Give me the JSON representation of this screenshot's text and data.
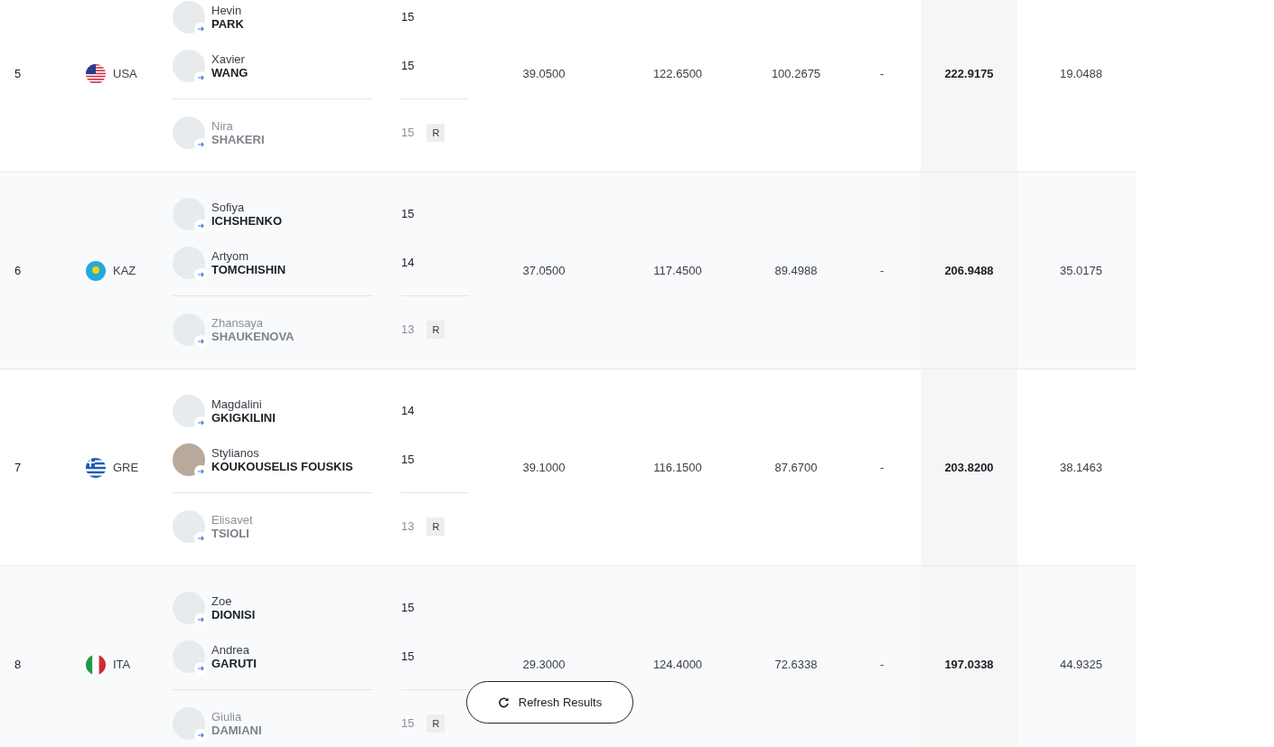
{
  "rows": [
    {
      "rank": "5",
      "country": "USA",
      "kind": "us",
      "athletes": [
        {
          "first": "Hevin",
          "last": "PARK",
          "score": "15",
          "reserve": false,
          "photo": false
        },
        {
          "first": "Xavier",
          "last": "WANG",
          "score": "15",
          "reserve": false,
          "photo": false
        },
        {
          "first": "Nira",
          "last": "SHAKERI",
          "score": "15",
          "reserve": true,
          "badge": "R",
          "photo": false
        }
      ],
      "values": [
        "39.0500",
        "122.6500",
        "100.2675",
        "-"
      ],
      "total": "222.9175",
      "gap": "19.0488"
    },
    {
      "rank": "6",
      "country": "KAZ",
      "kind": "kz",
      "athletes": [
        {
          "first": "Sofiya",
          "last": "ICHSHENKO",
          "score": "15",
          "reserve": false,
          "photo": false
        },
        {
          "first": "Artyom",
          "last": "TOMCHISHIN",
          "score": "14",
          "reserve": false,
          "photo": false
        },
        {
          "first": "Zhansaya",
          "last": "SHAUKENOVA",
          "score": "13",
          "reserve": true,
          "badge": "R",
          "photo": false
        }
      ],
      "values": [
        "37.0500",
        "117.4500",
        "89.4988",
        "-"
      ],
      "total": "206.9488",
      "gap": "35.0175"
    },
    {
      "rank": "7",
      "country": "GRE",
      "kind": "gr",
      "athletes": [
        {
          "first": "Magdalini",
          "last": "GKIGKILINI",
          "score": "14",
          "reserve": false,
          "photo": false
        },
        {
          "first": "Stylianos",
          "last": "KOUKOUSELIS FOUSKIS",
          "score": "15",
          "reserve": false,
          "photo": true
        },
        {
          "first": "Elisavet",
          "last": "TSIOLI",
          "score": "13",
          "reserve": true,
          "badge": "R",
          "photo": false
        }
      ],
      "values": [
        "39.1000",
        "116.1500",
        "87.6700",
        "-"
      ],
      "total": "203.8200",
      "gap": "38.1463"
    },
    {
      "rank": "8",
      "country": "ITA",
      "kind": "it",
      "athletes": [
        {
          "first": "Zoe",
          "last": "DIONISI",
          "score": "15",
          "reserve": false,
          "photo": false
        },
        {
          "first": "Andrea",
          "last": "GARUTI",
          "score": "15",
          "reserve": false,
          "photo": false
        },
        {
          "first": "Giulia",
          "last": "DAMIANI",
          "score": "15",
          "reserve": true,
          "badge": "R",
          "photo": false
        }
      ],
      "values": [
        "29.3000",
        "124.4000",
        "72.6338",
        "-"
      ],
      "total": "197.0338",
      "gap": "44.9325"
    }
  ],
  "refresh_button": {
    "label": "Refresh Results"
  }
}
